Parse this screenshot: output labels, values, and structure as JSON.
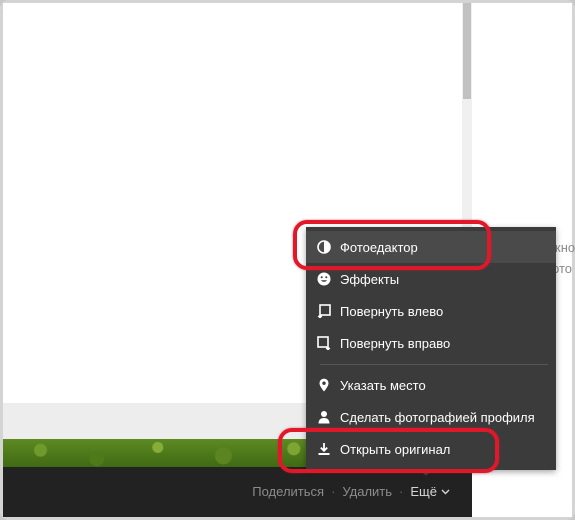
{
  "right_pane_hints": [
    "жно",
    "рто"
  ],
  "footer": {
    "share_label": "Поделиться",
    "delete_label": "Удалить",
    "more_label": "Ещё",
    "separator": "·"
  },
  "menu": {
    "items": [
      {
        "label": "Фотоедактор",
        "icon": "contrast-icon"
      },
      {
        "label": "Эффекты",
        "icon": "smiley-icon"
      },
      {
        "label": "Повернуть влево",
        "icon": "rotate-left-icon"
      },
      {
        "label": "Повернуть вправо",
        "icon": "rotate-right-icon"
      },
      {
        "label": "Указать место",
        "icon": "map-pin-icon"
      },
      {
        "label": "Сделать фотографией профиля",
        "icon": "user-icon"
      },
      {
        "label": "Открыть оригинал",
        "icon": "download-icon"
      }
    ]
  },
  "colors": {
    "menu_bg": "#3b3b3b",
    "footer_bg": "#222222",
    "annotation": "#e0182a"
  }
}
